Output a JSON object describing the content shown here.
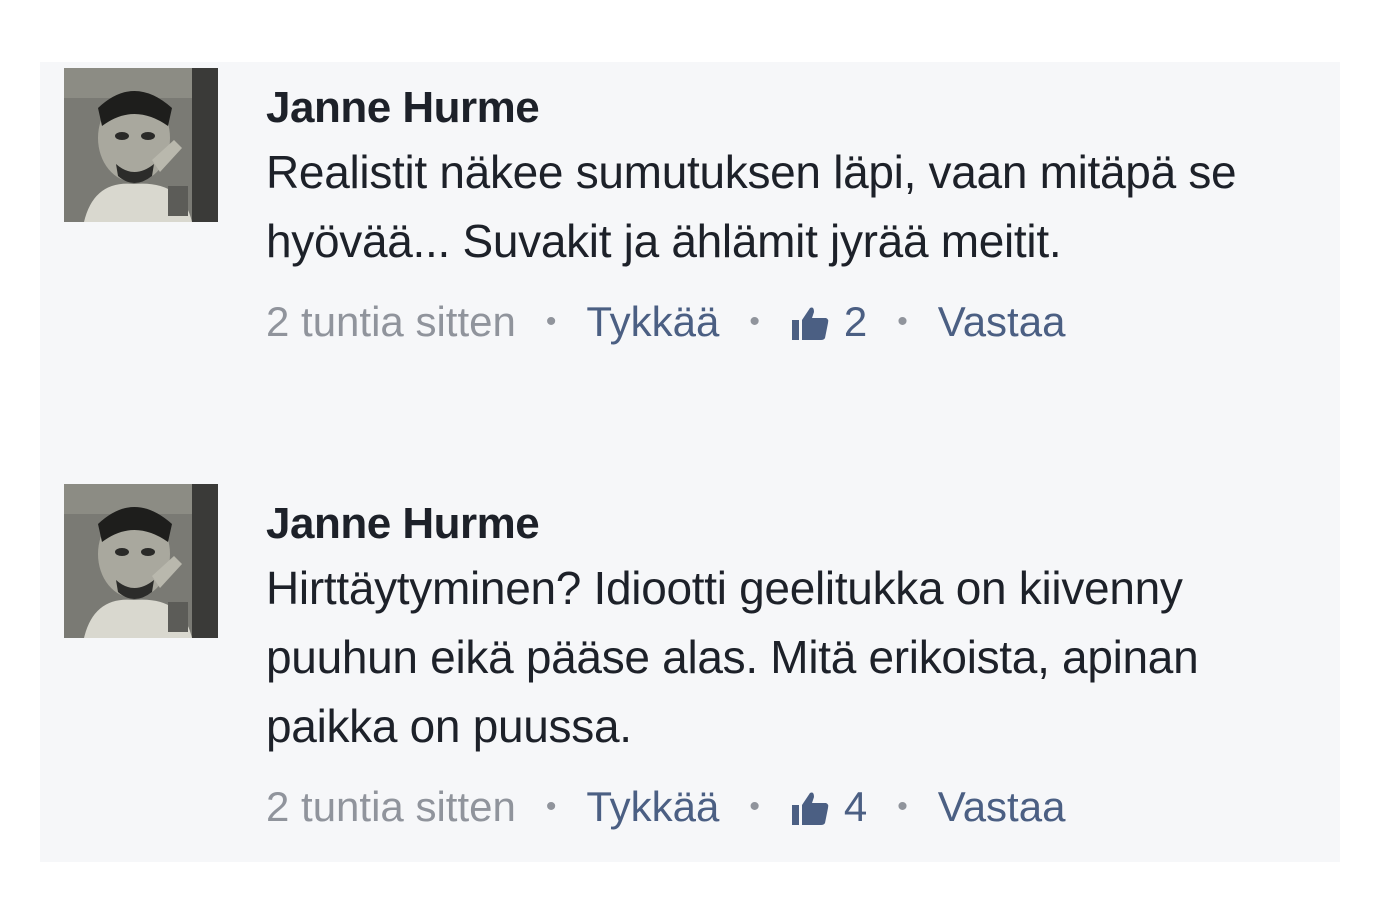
{
  "comments": [
    {
      "author": "Janne Hurme",
      "text": "Realistit näkee sumutuksen läpi, vaan mitäpä se hyövää... Suvakit ja ählämit jyrää meitit.",
      "time": "2 tuntia sitten",
      "like_label": "Tykkää",
      "like_count": "2",
      "reply_label": "Vastaa",
      "separator": "•",
      "icons": {
        "avatar": "profile-photo",
        "like": "thumbs-up-icon"
      }
    },
    {
      "author": "Janne Hurme",
      "text": "Hirttäytyminen? Idiootti geelitukka on kiivenny puuhun eikä pääse alas. Mitä erikoista, apinan paikka on puussa.",
      "time": "2 tuntia sitten",
      "like_label": "Tykkää",
      "like_count": "4",
      "reply_label": "Vastaa",
      "separator": "•",
      "icons": {
        "avatar": "profile-photo",
        "like": "thumbs-up-icon"
      }
    }
  ],
  "colors": {
    "name": "#1d2129",
    "text": "#1d2129",
    "timestamp": "#90949c",
    "action_link": "#4b5f83",
    "background": "#f6f7f9"
  }
}
